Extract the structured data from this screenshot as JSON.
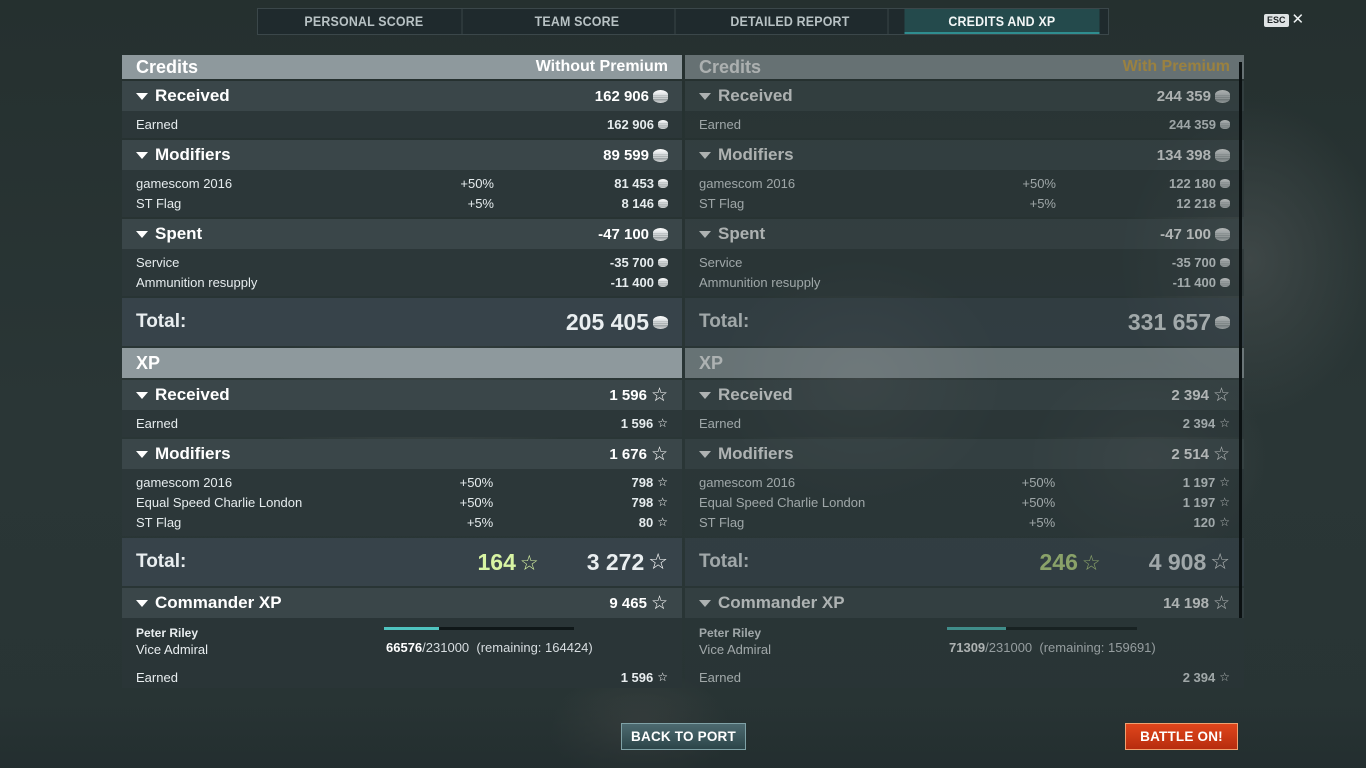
{
  "tabs": [
    {
      "label": "PERSONAL SCORE",
      "active": false
    },
    {
      "label": "TEAM SCORE",
      "active": false
    },
    {
      "label": "DETAILED REPORT",
      "active": false
    },
    {
      "label": "CREDITS AND XP",
      "active": true
    }
  ],
  "esc_label": "ESC",
  "close_glyph": "✕",
  "left": {
    "credits_title": "Credits",
    "credits_subtitle": "Without Premium",
    "received": {
      "label": "Received",
      "value": "162 906"
    },
    "earned": {
      "label": "Earned",
      "value": "162 906"
    },
    "modifiers": {
      "label": "Modifiers",
      "value": "89 599"
    },
    "mod_rows": [
      {
        "label": "gamescom 2016",
        "pct": "+50%",
        "value": "81 453"
      },
      {
        "label": "ST Flag",
        "pct": "+5%",
        "value": "8 146"
      }
    ],
    "spent": {
      "label": "Spent",
      "value": "-47 100"
    },
    "spent_rows": [
      {
        "label": "Service",
        "value": "-35 700"
      },
      {
        "label": "Ammunition resupply",
        "value": "-11 400"
      }
    ],
    "credits_total": {
      "label": "Total:",
      "value": "205 405"
    },
    "xp_title": "XP",
    "xp_received": {
      "label": "Received",
      "value": "1 596"
    },
    "xp_earned": {
      "label": "Earned",
      "value": "1 596"
    },
    "xp_modifiers": {
      "label": "Modifiers",
      "value": "1 676"
    },
    "xp_mod_rows": [
      {
        "label": "gamescom 2016",
        "pct": "+50%",
        "value": "798"
      },
      {
        "label": "Equal Speed Charlie London",
        "pct": "+50%",
        "value": "798"
      },
      {
        "label": "ST Flag",
        "pct": "+5%",
        "value": "80"
      }
    ],
    "xp_total": {
      "label": "Total:",
      "bonus": "164",
      "value": "3 272"
    },
    "commander_xp": {
      "label": "Commander XP",
      "value": "9 465"
    },
    "commander": {
      "name": "Peter Riley",
      "rank": "Vice Admiral",
      "current": "66576",
      "target": "/231000",
      "remaining": "(remaining: 164424)",
      "progress_fraction": 0.288,
      "earned_label": "Earned",
      "earned_value": "1 596"
    }
  },
  "right": {
    "credits_title": "Credits",
    "credits_subtitle": "With Premium",
    "received": {
      "label": "Received",
      "value": "244 359"
    },
    "earned": {
      "label": "Earned",
      "value": "244 359"
    },
    "modifiers": {
      "label": "Modifiers",
      "value": "134 398"
    },
    "mod_rows": [
      {
        "label": "gamescom 2016",
        "pct": "+50%",
        "value": "122 180"
      },
      {
        "label": "ST Flag",
        "pct": "+5%",
        "value": "12 218"
      }
    ],
    "spent": {
      "label": "Spent",
      "value": "-47 100"
    },
    "spent_rows": [
      {
        "label": "Service",
        "value": "-35 700"
      },
      {
        "label": "Ammunition resupply",
        "value": "-11 400"
      }
    ],
    "credits_total": {
      "label": "Total:",
      "value": "331 657"
    },
    "xp_title": "XP",
    "xp_received": {
      "label": "Received",
      "value": "2 394"
    },
    "xp_earned": {
      "label": "Earned",
      "value": "2 394"
    },
    "xp_modifiers": {
      "label": "Modifiers",
      "value": "2 514"
    },
    "xp_mod_rows": [
      {
        "label": "gamescom 2016",
        "pct": "+50%",
        "value": "1 197"
      },
      {
        "label": "Equal Speed Charlie London",
        "pct": "+50%",
        "value": "1 197"
      },
      {
        "label": "ST Flag",
        "pct": "+5%",
        "value": "120"
      }
    ],
    "xp_total": {
      "label": "Total:",
      "bonus": "246",
      "value": "4 908"
    },
    "commander_xp": {
      "label": "Commander XP",
      "value": "14 198"
    },
    "commander": {
      "name": "Peter Riley",
      "rank": "Vice Admiral",
      "current": "71309",
      "target": "/231000",
      "remaining": "(remaining: 159691)",
      "progress_fraction": 0.309,
      "earned_label": "Earned",
      "earned_value": "2 394"
    }
  },
  "buttons": {
    "back": "BACK TO PORT",
    "battle": "BATTLE ON!"
  },
  "colors": {
    "accent_teal": "#2f8d8f",
    "premium_gold": "#e2b24a",
    "battle_red": "#c9350f",
    "bonus_green": "#d8f4a3"
  },
  "icons": {
    "credits": "coin-stack-icon",
    "xp": "star-outline-icon",
    "collapse": "triangle-down-icon"
  }
}
